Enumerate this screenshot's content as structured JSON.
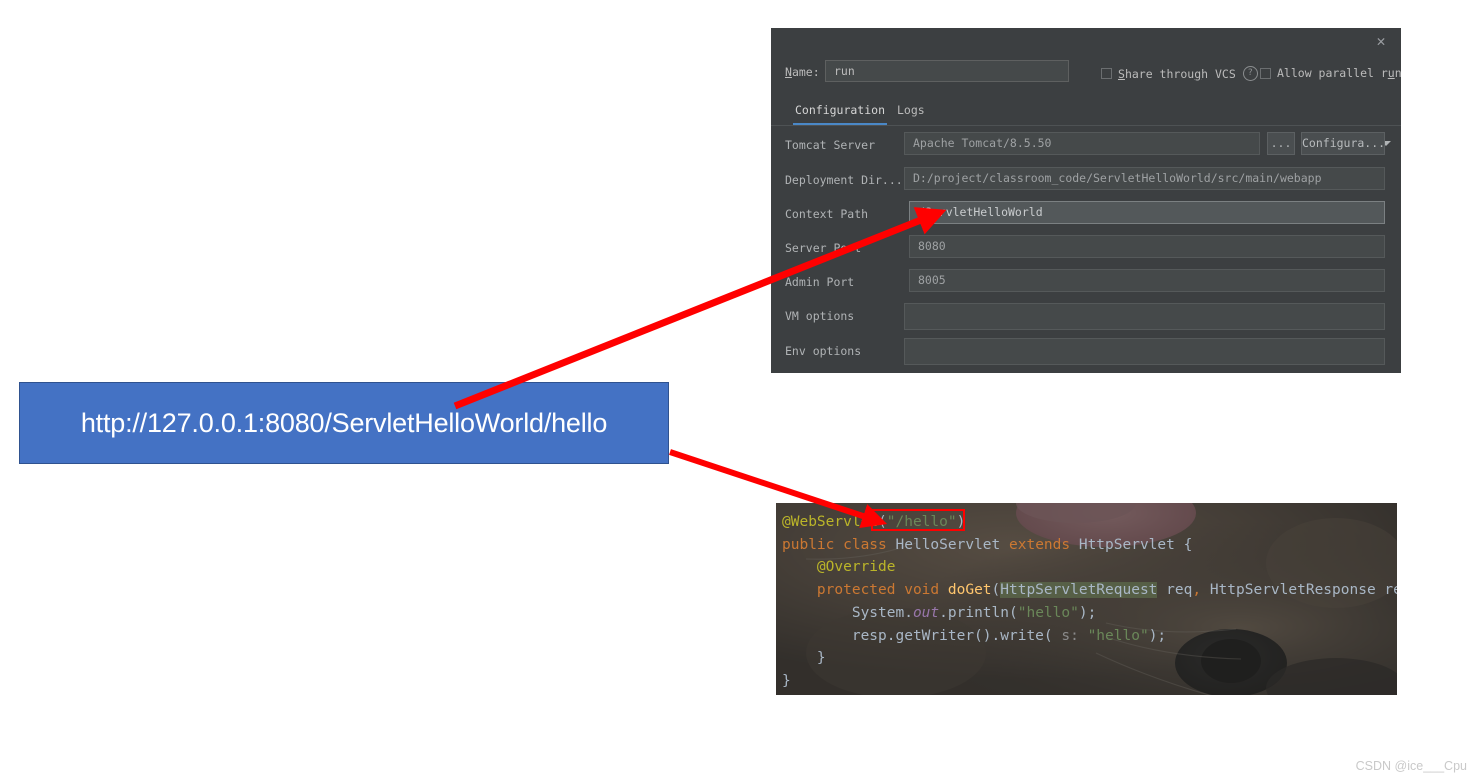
{
  "dialog": {
    "close_icon": "close-icon",
    "name_label": "Name:",
    "name_value": "run",
    "share_vcs_label": "Share through VCS",
    "help_icon": "?",
    "allow_parallel_label": "Allow parallel run",
    "tabs": [
      {
        "label": "Configuration",
        "active": true
      },
      {
        "label": "Logs",
        "active": false
      }
    ],
    "fields": [
      {
        "label": "Tomcat Server",
        "value": "Apache Tomcat/8.5.50",
        "type": "select",
        "ellipsis_button": "...",
        "configure_button": "Configura..."
      },
      {
        "label": "Deployment Dir...",
        "value": "D:/project/classroom_code/ServletHelloWorld/src/main/webapp",
        "type": "text",
        "trailing_icon": "folder-icon"
      },
      {
        "label": "Context Path",
        "value": "/ServletHelloWorld",
        "type": "text",
        "focused": true
      },
      {
        "label": "Server Port",
        "value": "8080",
        "type": "text"
      },
      {
        "label": "Admin Port",
        "value": "8005",
        "type": "text"
      },
      {
        "label": "VM options",
        "value": "",
        "type": "text",
        "trailing_icon": "expand-icon"
      },
      {
        "label": "Env options",
        "value": "",
        "type": "text",
        "trailing_icon": "list-icon"
      }
    ]
  },
  "callout": {
    "url": "http://127.0.0.1:8080/ServletHelloWorld/hello",
    "fill_color": "#4472c4",
    "border_color": "#2f528f",
    "text_color": "#ffffff"
  },
  "annotations": {
    "arrow_color": "#ff0000",
    "highlight_box_color": "#ff0000",
    "arrow_from_callout_to_context_path": "Context Path",
    "arrow_from_callout_to_webservlet": "@WebServlet(\"/hello\")"
  },
  "code": {
    "lines": [
      "@WebServlet(\"/hello\")",
      "public class HelloServlet extends HttpServlet {",
      "    @Override",
      "    protected void doGet(HttpServletRequest req, HttpServletResponse resp)",
      "        System.out.println(\"hello\");",
      "        resp.getWriter().write( s: \"hello\");",
      "    }",
      "}"
    ],
    "highlighted_token": "\"/hello\")"
  },
  "watermark": "CSDN @ice___Cpu"
}
